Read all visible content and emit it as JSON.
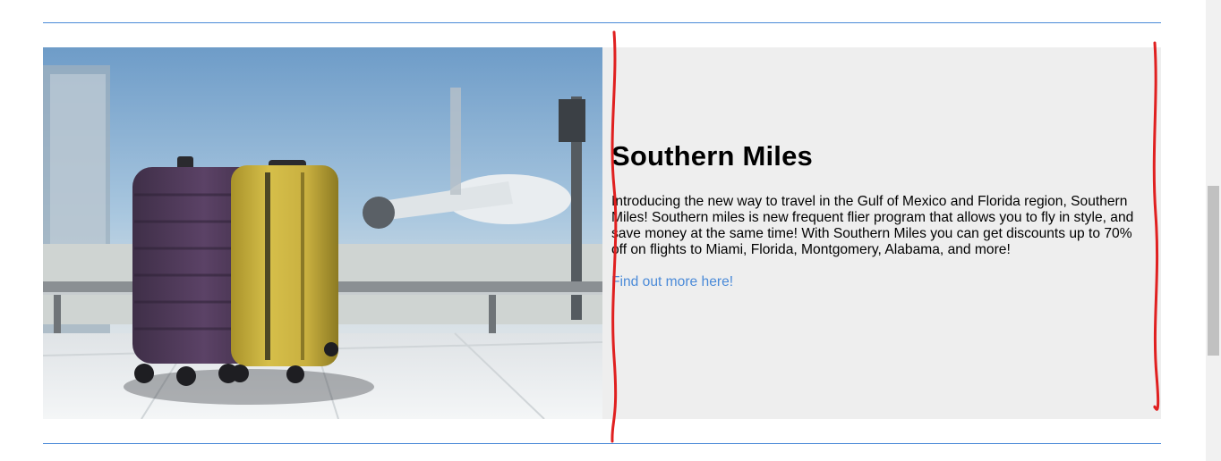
{
  "feature": {
    "title": "Southern Miles",
    "description": "Introducing the new way to travel in the Gulf of Mexico and Florida region, Southern Miles! Southern miles is new frequent flier program that allows you to fly in style, and save money at the same time! With Southern Miles you can get discounts up to 70% off on flights to Miami, Florida, Montgomery, Alabama, and more!",
    "link_label": "Find out more here!"
  },
  "colors": {
    "accent": "#4a8ad8",
    "panel_bg": "#eeeeee",
    "annotation": "#e02020"
  },
  "image": {
    "subject": "two suitcases (purple and yellow) at airport window with airplane"
  }
}
